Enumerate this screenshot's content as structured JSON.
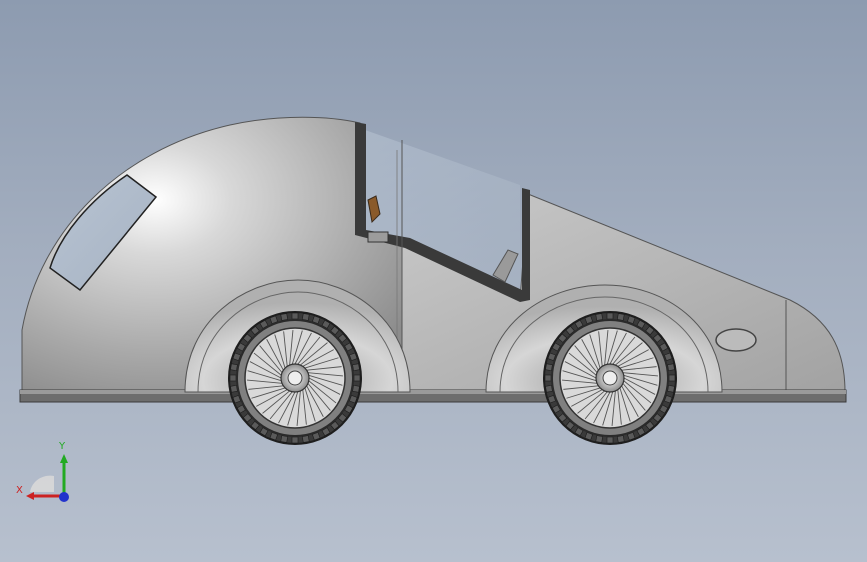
{
  "viewport": {
    "background_top": "#8d9bb0",
    "background_bottom": "#b7c0ce"
  },
  "model": {
    "body_color": "#c4c4c4",
    "frame_color": "#3a3a3a",
    "accent_color": "#8a5a2a"
  },
  "triad": {
    "x_label": "X",
    "y_label": "Y",
    "x_color": "#cc2222",
    "y_color": "#22aa22",
    "z_color": "#2233cc"
  }
}
